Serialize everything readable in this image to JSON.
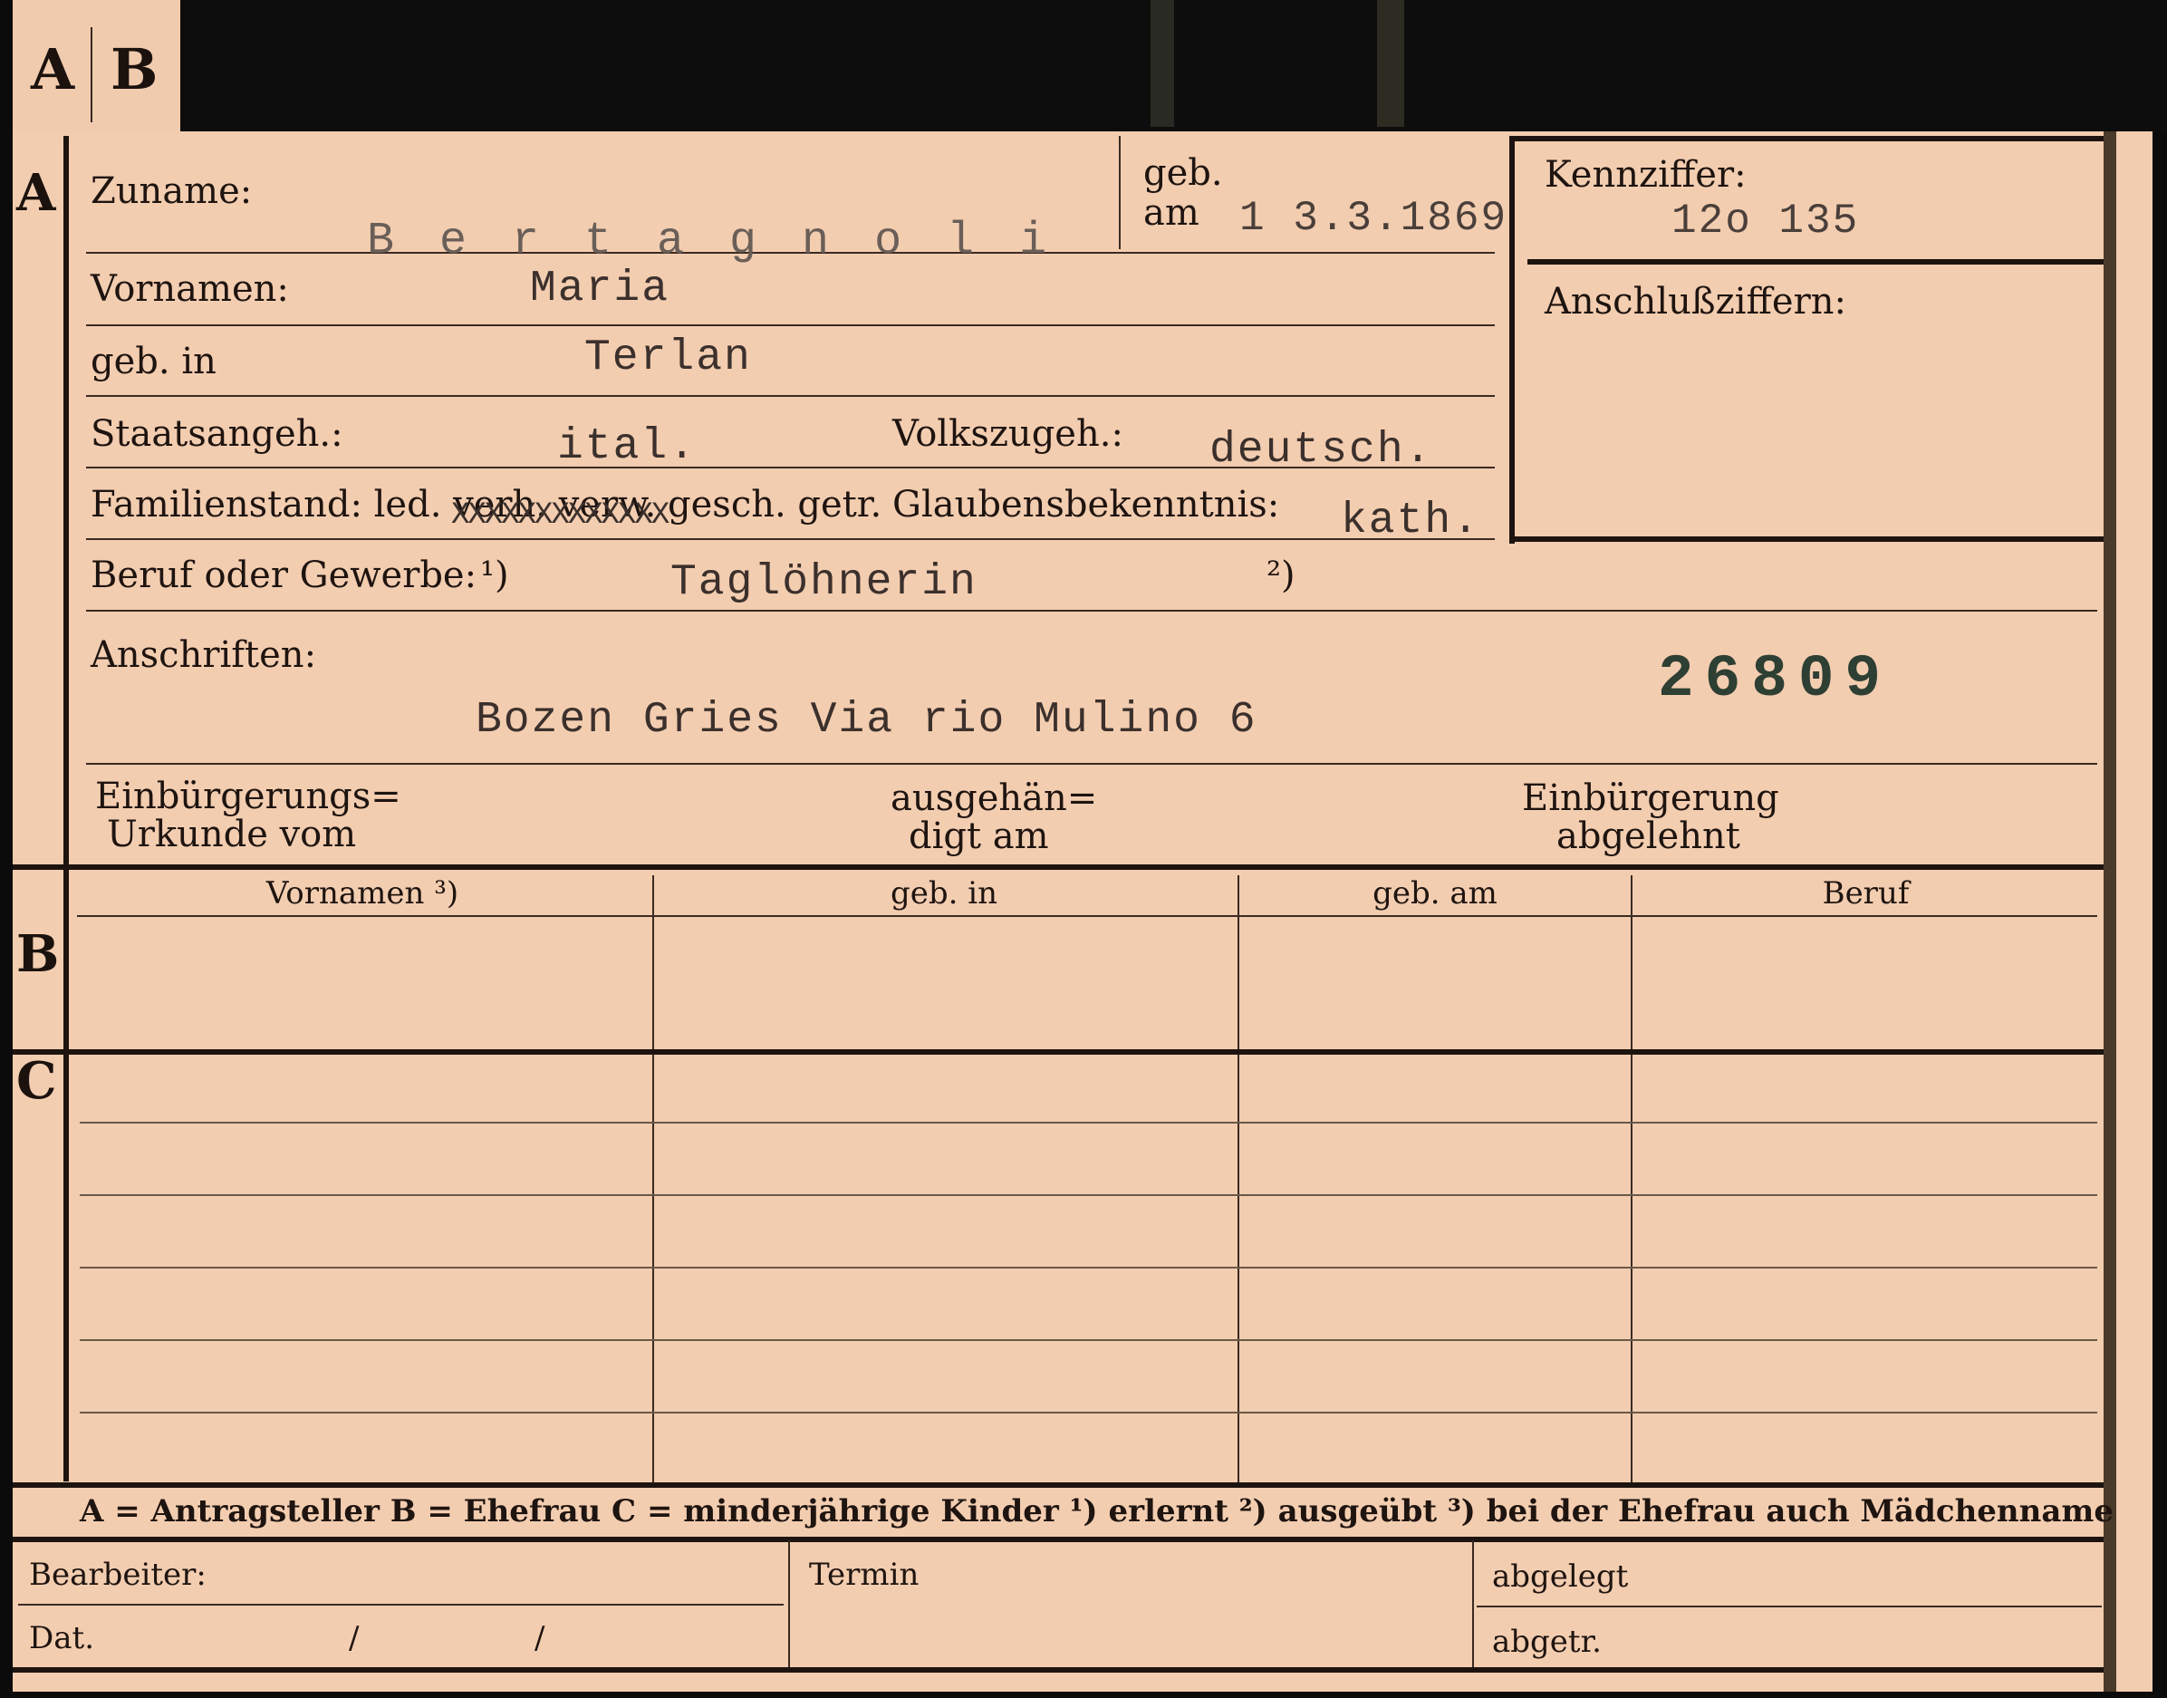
{
  "tab": {
    "a": "A",
    "b": "B"
  },
  "sections": {
    "a": "A",
    "b": "B",
    "c": "C"
  },
  "labels": {
    "zuname": "Zuname:",
    "geb": "geb.",
    "am": "am",
    "kennziffer": "Kennziffer:",
    "anschlussziffern": "Anschlußziffern:",
    "vornamen": "Vornamen:",
    "geb_in": "geb. in",
    "staatsangeh": "Staatsangeh.:",
    "volkszugeh": "Volkszugeh.:",
    "familienstand": "Familienstand: led. verh. verw. gesch. getr.",
    "glaubensbekenntnis": "Glaubensbekenntnis:",
    "beruf": "Beruf oder Gewerbe:",
    "note1": "¹)",
    "note2": "²)",
    "anschriften": "Anschriften:",
    "einbuerg_urkunde_1": "Einbürgerungs=",
    "einbuerg_urkunde_2": "Urkunde vom",
    "ausgehaen_1": "ausgehän=",
    "ausgehaen_2": "digt am",
    "einbuerg_abgelehnt_1": "Einbürgerung",
    "einbuerg_abgelehnt_2": "abgelehnt"
  },
  "values": {
    "zuname": "B e r t a g n o l i",
    "geb_am": "1 3.3.1869",
    "kennziffer": "12o 135",
    "vornamen": "Maria",
    "geb_in": "Terlan",
    "staatsangeh": "ital.",
    "volkszugeh": "deutsch.",
    "familienstand_strike": "XXXXXXXXXXXXX",
    "glaubensbekenntnis": "kath.",
    "beruf": "Taglöhnerin",
    "anschrift": "Bozen Gries Via rio Mulino 6",
    "nummer": "26809"
  },
  "columns": [
    "Vornamen ³)",
    "geb. in",
    "geb. am",
    "Beruf"
  ],
  "legend": "A = Antragsteller   B = Ehefrau   C = minderjährige Kinder   ¹) erlernt   ²) ausgeübt   ³) bei der Ehefrau auch Mädchenname",
  "footer": {
    "bearbeiter": "Bearbeiter:",
    "dat": "Dat.",
    "slash1": "/",
    "slash2": "/",
    "termin": "Termin",
    "abgelegt": "abgelegt",
    "abgetr": "abgetr."
  }
}
